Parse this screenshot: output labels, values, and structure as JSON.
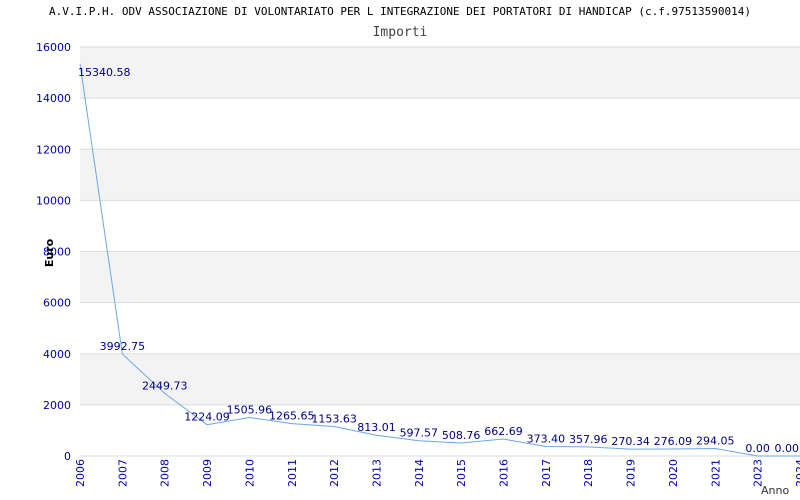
{
  "title": "A.V.I.P.H. ODV ASSOCIAZIONE DI VOLONTARIATO PER L INTEGRAZIONE DEI PORTATORI DI HANDICAP (c.f.97513590014)",
  "subtitle": "Importi",
  "colors": {
    "line": "#6aa8e8",
    "axis_text": "#0000aa",
    "band": "#f3f3f3",
    "grid": "#dddddd"
  },
  "chart_data": {
    "type": "line",
    "title": "A.V.I.P.H. ODV ASSOCIAZIONE DI VOLONTARIATO PER L INTEGRAZIONE DEI PORTATORI DI HANDICAP (c.f.97513590014)",
    "subtitle": "Importi",
    "xlabel": "Anno",
    "ylabel": "Euro",
    "ylim": [
      0,
      16000
    ],
    "yticks": [
      0,
      2000,
      4000,
      6000,
      8000,
      10000,
      12000,
      14000,
      16000
    ],
    "grid": true,
    "categories": [
      "2006",
      "2007",
      "2008",
      "2009",
      "2010",
      "2011",
      "2012",
      "2013",
      "2014",
      "2015",
      "2016",
      "2017",
      "2018",
      "2019",
      "2020",
      "2021",
      "2023",
      "2024"
    ],
    "values": [
      15340.58,
      3992.75,
      2449.73,
      1224.09,
      1505.96,
      1265.65,
      1153.63,
      813.01,
      597.57,
      508.76,
      662.69,
      373.4,
      357.96,
      270.34,
      276.09,
      294.05,
      0.0,
      0.0
    ],
    "value_labels": [
      "15340.58",
      "3992.75",
      "2449.73",
      "1224.09",
      "1505.96",
      "1265.65",
      "1153.63",
      "813.01",
      "597.57",
      "508.76",
      "662.69",
      "373.40",
      "357.96",
      "270.34",
      "276.09",
      "294.05",
      "0.00",
      "0.00"
    ]
  }
}
